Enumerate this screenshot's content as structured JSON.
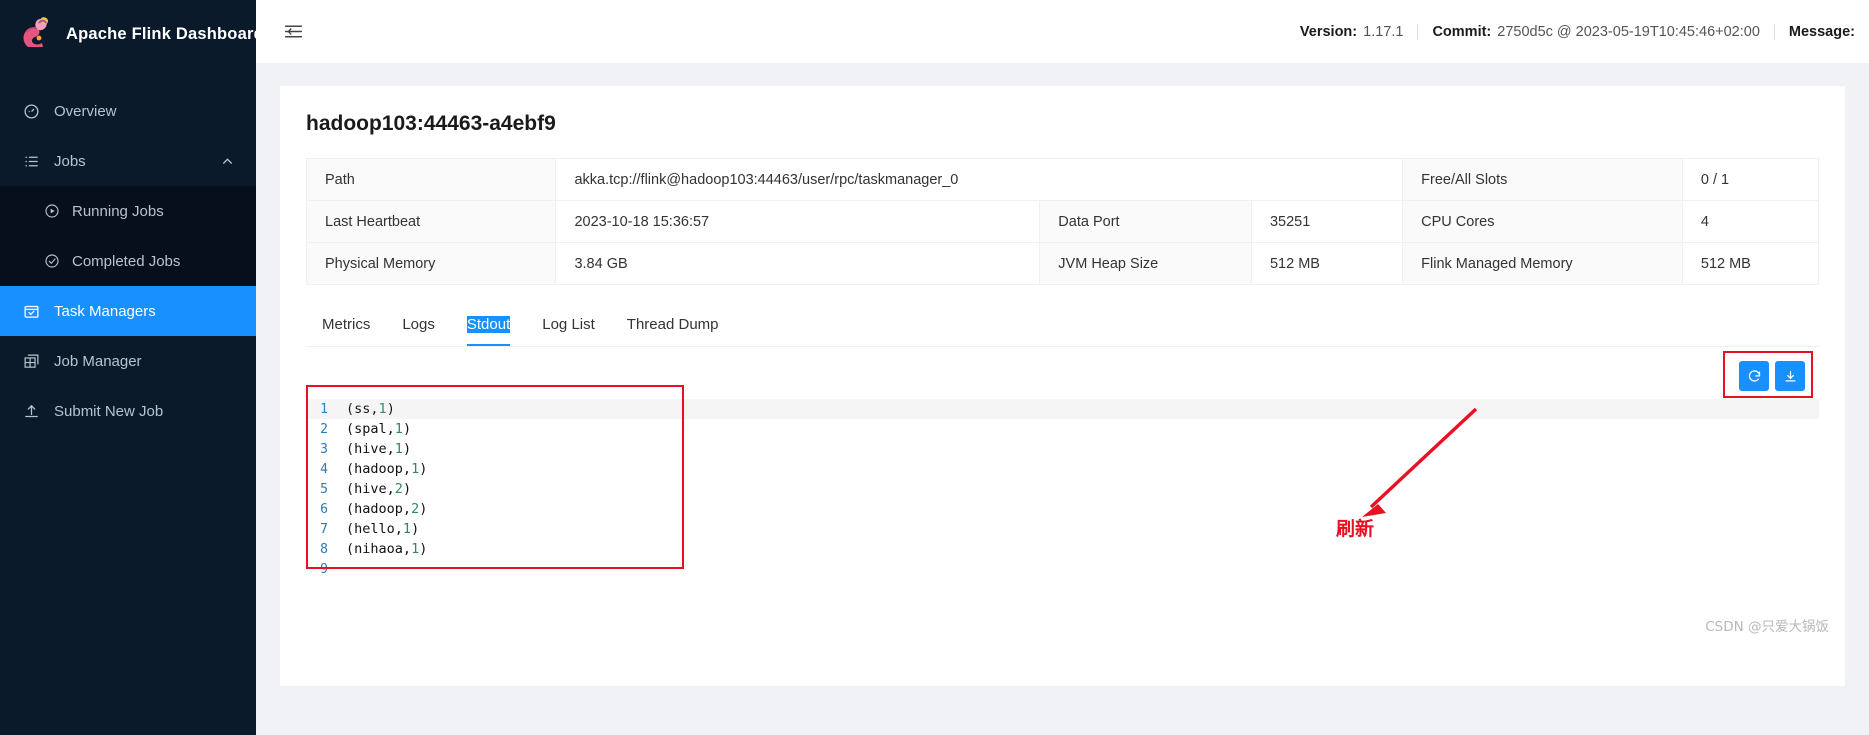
{
  "sidebar": {
    "brand": "Apache Flink Dashboard",
    "items": [
      {
        "label": "Overview",
        "icon": "gauge-icon"
      },
      {
        "label": "Jobs",
        "icon": "list-icon",
        "expanded": true
      },
      {
        "label": "Task Managers",
        "icon": "calendar-check-icon",
        "active": true
      },
      {
        "label": "Job Manager",
        "icon": "grid-icon"
      },
      {
        "label": "Submit New Job",
        "icon": "upload-icon"
      }
    ],
    "sub_items": [
      {
        "label": "Running Jobs",
        "icon": "play-circle-icon"
      },
      {
        "label": "Completed Jobs",
        "icon": "check-circle-icon"
      }
    ]
  },
  "header": {
    "menu_icon": "hamburger-menu-icon",
    "version_label": "Version:",
    "version_value": "1.17.1",
    "commit_label": "Commit:",
    "commit_value": "2750d5c @ 2023-05-19T10:45:46+02:00",
    "message_label": "Message:"
  },
  "page": {
    "title": "hadoop103:44463-a4ebf9"
  },
  "info_table": [
    [
      {
        "type": "key",
        "text": "Path"
      },
      {
        "type": "value",
        "text": "akka.tcp://flink@hadoop103:44463/user/rpc/taskmanager_0",
        "span": 3
      },
      {
        "type": "key",
        "text": "Free/All Slots"
      },
      {
        "type": "value",
        "text": "0 / 1"
      }
    ],
    [
      {
        "type": "key",
        "text": "Last Heartbeat"
      },
      {
        "type": "value",
        "text": "2023-10-18 15:36:57"
      },
      {
        "type": "key",
        "text": "Data Port"
      },
      {
        "type": "value",
        "text": "35251"
      },
      {
        "type": "key",
        "text": "CPU Cores"
      },
      {
        "type": "value",
        "text": "4"
      }
    ],
    [
      {
        "type": "key",
        "text": "Physical Memory"
      },
      {
        "type": "value",
        "text": "3.84 GB"
      },
      {
        "type": "key",
        "text": "JVM Heap Size"
      },
      {
        "type": "value",
        "text": "512 MB"
      },
      {
        "type": "key",
        "text": "Flink Managed Memory"
      },
      {
        "type": "value",
        "text": "512 MB"
      }
    ]
  ],
  "tabs": [
    {
      "label": "Metrics",
      "active": false
    },
    {
      "label": "Logs",
      "active": false
    },
    {
      "label": "Stdout",
      "active": true
    },
    {
      "label": "Log List",
      "active": false
    },
    {
      "label": "Thread Dump",
      "active": false
    }
  ],
  "log_actions": [
    {
      "name": "refresh-button",
      "icon": "refresh-icon"
    },
    {
      "name": "download-button",
      "icon": "download-icon"
    }
  ],
  "stdout": {
    "lines": [
      {
        "n": "1",
        "word": "ss",
        "count": "1"
      },
      {
        "n": "2",
        "word": "spal",
        "count": "1"
      },
      {
        "n": "3",
        "word": "hive",
        "count": "1"
      },
      {
        "n": "4",
        "word": "hadoop",
        "count": "1"
      },
      {
        "n": "5",
        "word": "hive",
        "count": "2"
      },
      {
        "n": "6",
        "word": "hadoop",
        "count": "2"
      },
      {
        "n": "7",
        "word": "hello",
        "count": "1"
      },
      {
        "n": "8",
        "word": "nihaoa",
        "count": "1"
      },
      {
        "n": "9",
        "word": "",
        "count": ""
      }
    ]
  },
  "annotations": {
    "refresh_note": "刷新"
  },
  "watermark": "CSDN @只爱大锅饭",
  "colors": {
    "accent": "#1890ff",
    "sidebar_bg": "#0b1a2b",
    "annotation_red": "#e81123"
  }
}
